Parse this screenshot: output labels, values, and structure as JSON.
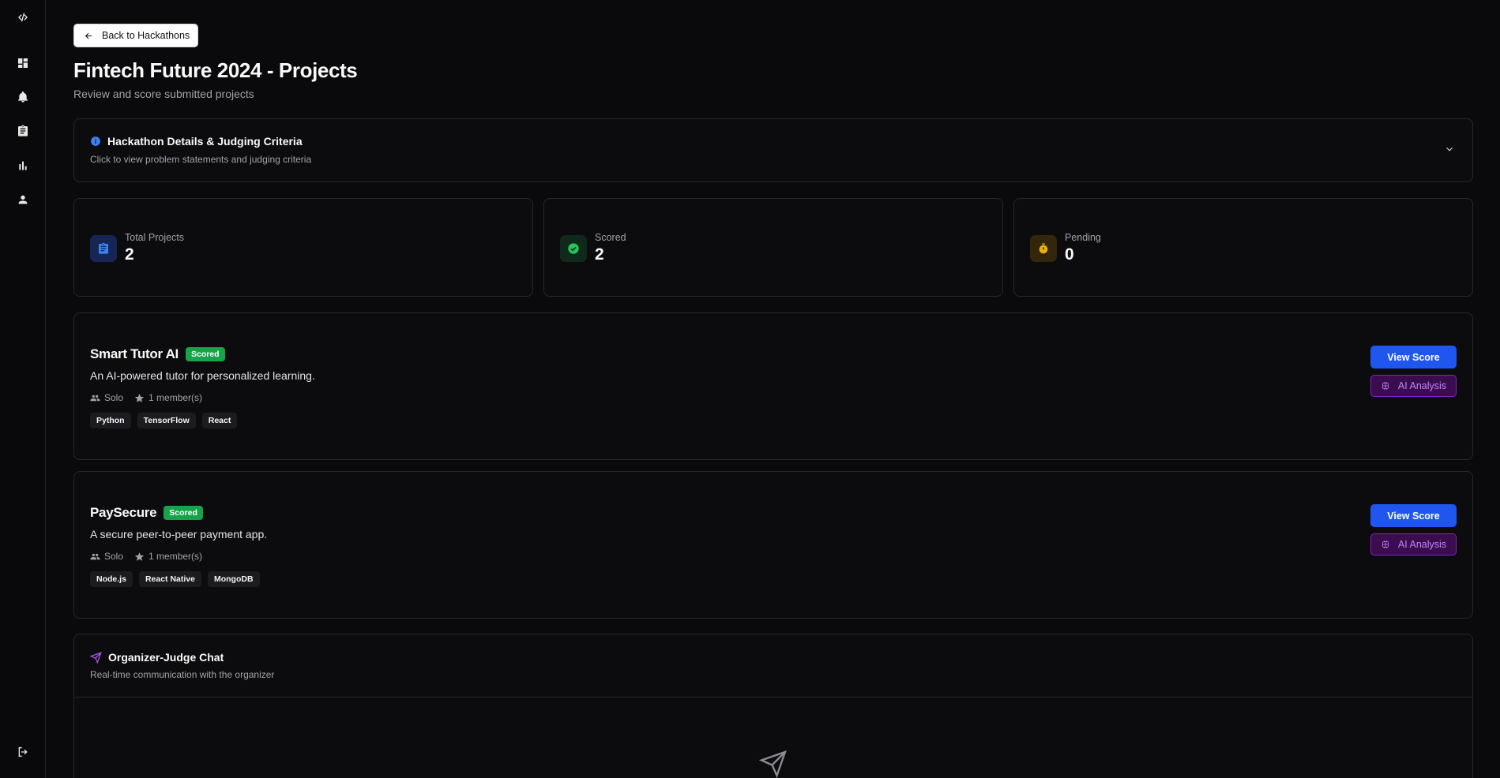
{
  "sidebar": {
    "items": [
      {
        "name": "code-icon"
      },
      {
        "name": "dashboard-icon"
      },
      {
        "name": "bell-icon"
      },
      {
        "name": "clipboard-icon"
      },
      {
        "name": "bar-chart-icon"
      },
      {
        "name": "user-icon"
      },
      {
        "name": "logout-icon"
      }
    ]
  },
  "header": {
    "back_label": "Back to Hackathons",
    "title": "Fintech Future 2024 - Projects",
    "subtitle": "Review and score submitted projects"
  },
  "details": {
    "title": "Hackathon Details & Judging Criteria",
    "description": "Click to view problem statements and judging criteria",
    "icon": "info-icon",
    "expanded": false
  },
  "stats": [
    {
      "label": "Total Projects",
      "value": "2",
      "icon": "clipboard-icon",
      "color": "#3b82f6"
    },
    {
      "label": "Scored",
      "value": "2",
      "icon": "check-circle-icon",
      "color": "#22c55e"
    },
    {
      "label": "Pending",
      "value": "0",
      "icon": "timer-icon",
      "color": "#eab308"
    }
  ],
  "projects": [
    {
      "name": "Smart Tutor AI",
      "status": "Scored",
      "description": "An AI-powered tutor for personalized learning.",
      "team_type": "Solo",
      "members": "1 member(s)",
      "tags": [
        "Python",
        "TensorFlow",
        "React"
      ],
      "view_label": "View Score",
      "ai_label": "AI Analysis"
    },
    {
      "name": "PaySecure",
      "status": "Scored",
      "description": "A secure peer-to-peer payment app.",
      "team_type": "Solo",
      "members": "1 member(s)",
      "tags": [
        "Node.js",
        "React Native",
        "MongoDB"
      ],
      "view_label": "View Score",
      "ai_label": "AI Analysis"
    }
  ],
  "chat": {
    "title": "Organizer-Judge Chat",
    "description": "Real-time communication with the organizer",
    "icon": "send-icon"
  },
  "colors": {
    "background": "#0a0a0c",
    "accent_blue": "#1f56f0",
    "badge_green": "#16a34a",
    "ai_purple": "#c084fc"
  }
}
